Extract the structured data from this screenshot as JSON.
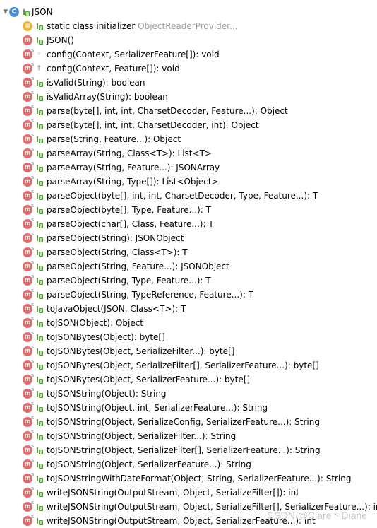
{
  "tree": {
    "root": {
      "label": "JSON",
      "icon": "class-icon",
      "expanded": true
    },
    "items": [
      {
        "kind": "field",
        "visibility": "public",
        "label": "static class initializer",
        "detail": "ObjectReaderProvider..."
      },
      {
        "kind": "method",
        "visibility": "public",
        "label": "JSON()",
        "static": false
      },
      {
        "kind": "method",
        "visibility": "package",
        "label": "config(Context, SerializerFeature[]): void",
        "static": true
      },
      {
        "kind": "method",
        "visibility": "protected",
        "label": "config(Context, Feature[]): void",
        "static": true
      },
      {
        "kind": "method",
        "visibility": "public",
        "label": "isValid(String): boolean",
        "static": true
      },
      {
        "kind": "method",
        "visibility": "public",
        "label": "isValidArray(String): boolean",
        "static": true
      },
      {
        "kind": "method",
        "visibility": "public",
        "label": "parse(byte[], int, int, CharsetDecoder, Feature...): Object",
        "static": true
      },
      {
        "kind": "method",
        "visibility": "public",
        "label": "parse(byte[], int, int, CharsetDecoder, int): Object",
        "static": true
      },
      {
        "kind": "method",
        "visibility": "public",
        "label": "parse(String, Feature...): Object",
        "static": true
      },
      {
        "kind": "method",
        "visibility": "public",
        "label": "parseArray(String, Class<T>): List<T>",
        "static": true
      },
      {
        "kind": "method",
        "visibility": "public",
        "label": "parseArray(String, Feature...): JSONArray",
        "static": true
      },
      {
        "kind": "method",
        "visibility": "public",
        "label": "parseArray(String, Type[]): List<Object>",
        "static": true
      },
      {
        "kind": "method",
        "visibility": "public",
        "label": "parseObject(byte[], int, int, CharsetDecoder, Type, Feature...): T",
        "static": true
      },
      {
        "kind": "method",
        "visibility": "public",
        "label": "parseObject(byte[], Type, Feature...): T",
        "static": true
      },
      {
        "kind": "method",
        "visibility": "public",
        "label": "parseObject(char[], Class, Feature...): T",
        "static": true
      },
      {
        "kind": "method",
        "visibility": "public",
        "label": "parseObject(String): JSONObject",
        "static": true
      },
      {
        "kind": "method",
        "visibility": "public",
        "label": "parseObject(String, Class<T>): T",
        "static": true
      },
      {
        "kind": "method",
        "visibility": "public",
        "label": "parseObject(String, Feature...): JSONObject",
        "static": true
      },
      {
        "kind": "method",
        "visibility": "public",
        "label": "parseObject(String, Type, Feature...): T",
        "static": true
      },
      {
        "kind": "method",
        "visibility": "public",
        "label": "parseObject(String, TypeReference, Feature...): T",
        "static": true
      },
      {
        "kind": "method",
        "visibility": "public",
        "label": "toJavaObject(JSON, Class<T>): T",
        "static": true
      },
      {
        "kind": "method",
        "visibility": "public",
        "label": "toJSON(Object): Object",
        "static": true
      },
      {
        "kind": "method",
        "visibility": "public",
        "label": "toJSONBytes(Object): byte[]",
        "static": true
      },
      {
        "kind": "method",
        "visibility": "public",
        "label": "toJSONBytes(Object, SerializeFilter...): byte[]",
        "static": true
      },
      {
        "kind": "method",
        "visibility": "public",
        "label": "toJSONBytes(Object, SerializeFilter[], SerializerFeature...): byte[]",
        "static": true
      },
      {
        "kind": "method",
        "visibility": "public",
        "label": "toJSONBytes(Object, SerializerFeature...): byte[]",
        "static": true
      },
      {
        "kind": "method",
        "visibility": "public",
        "label": "toJSONString(Object): String",
        "static": true
      },
      {
        "kind": "method",
        "visibility": "public",
        "label": "toJSONString(Object, int, SerializerFeature...): String",
        "static": true
      },
      {
        "kind": "method",
        "visibility": "public",
        "label": "toJSONString(Object, SerializeConfig, SerializerFeature...): String",
        "static": true
      },
      {
        "kind": "method",
        "visibility": "public",
        "label": "toJSONString(Object, SerializeFilter...): String",
        "static": true
      },
      {
        "kind": "method",
        "visibility": "public",
        "label": "toJSONString(Object, SerializeFilter[], SerializerFeature...): String",
        "static": true
      },
      {
        "kind": "method",
        "visibility": "public",
        "label": "toJSONString(Object, SerializerFeature...): String",
        "static": true
      },
      {
        "kind": "method",
        "visibility": "public",
        "label": "toJSONStringWithDateFormat(Object, String, SerializerFeature...): String",
        "static": true
      },
      {
        "kind": "method",
        "visibility": "public",
        "label": "writeJSONString(OutputStream, Object, SerializeFilter[]): int",
        "static": true
      },
      {
        "kind": "method",
        "visibility": "public",
        "label": "writeJSONString(OutputStream, Object, SerializeFilter[], SerializerFeature...): int",
        "static": true
      },
      {
        "kind": "method",
        "visibility": "public",
        "label": "writeJSONString(OutputStream, Object, SerializerFeature...): int",
        "static": true
      }
    ]
  },
  "watermark": "CSDN @Clare丶Diane",
  "colors": {
    "class_icon": "#4a8fd8",
    "method_icon": "#e66a6a",
    "field_icon": "#e8b43a",
    "public_marker": "#5a9f3a",
    "detail_text": "#9a9a9a"
  }
}
